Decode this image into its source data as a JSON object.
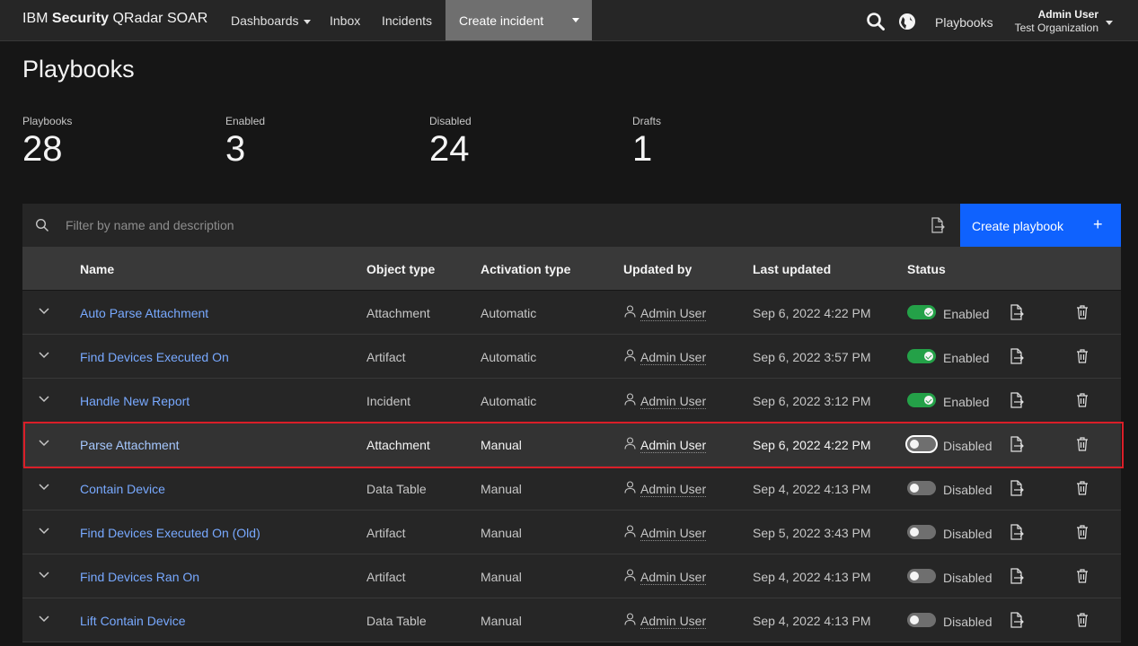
{
  "nav": {
    "brand_prefix": "IBM ",
    "brand_bold": "Security",
    "brand_suffix": " QRadar SOAR",
    "items": [
      "Dashboards",
      "Inbox",
      "Incidents"
    ],
    "create_incident": "Create incident",
    "playbooks_link": "Playbooks",
    "user_name": "Admin User",
    "user_org": "Test Organization",
    "icons": [
      "search-icon",
      "globe-icon"
    ]
  },
  "page": {
    "title": "Playbooks"
  },
  "stats": [
    {
      "label": "Playbooks",
      "value": "28"
    },
    {
      "label": "Enabled",
      "value": "3"
    },
    {
      "label": "Disabled",
      "value": "24"
    },
    {
      "label": "Drafts",
      "value": "1"
    }
  ],
  "toolbar": {
    "search_placeholder": "Filter by name and description",
    "create_label": "Create playbook",
    "create_icon": "+"
  },
  "table": {
    "columns": [
      "Name",
      "Object type",
      "Activation type",
      "Updated by",
      "Last updated",
      "Status"
    ],
    "rows": [
      {
        "name": "Auto Parse Attachment",
        "object_type": "Attachment",
        "activation": "Automatic",
        "updated_by": "Admin User",
        "last_updated": "Sep 6, 2022 4:22 PM",
        "status": "Enabled"
      },
      {
        "name": "Find Devices Executed On",
        "object_type": "Artifact",
        "activation": "Automatic",
        "updated_by": "Admin User",
        "last_updated": "Sep 6, 2022 3:57 PM",
        "status": "Enabled"
      },
      {
        "name": "Handle New Report",
        "object_type": "Incident",
        "activation": "Automatic",
        "updated_by": "Admin User",
        "last_updated": "Sep 6, 2022 3:12 PM",
        "status": "Enabled"
      },
      {
        "name": "Parse Attachment",
        "object_type": "Attachment",
        "activation": "Manual",
        "updated_by": "Admin User",
        "last_updated": "Sep 6, 2022 4:22 PM",
        "status": "Disabled"
      },
      {
        "name": "Contain Device",
        "object_type": "Data Table",
        "activation": "Manual",
        "updated_by": "Admin User",
        "last_updated": "Sep 4, 2022 4:13 PM",
        "status": "Disabled"
      },
      {
        "name": "Find Devices Executed On (Old)",
        "object_type": "Artifact",
        "activation": "Manual",
        "updated_by": "Admin User",
        "last_updated": "Sep 5, 2022 3:43 PM",
        "status": "Disabled"
      },
      {
        "name": "Find Devices Ran On",
        "object_type": "Artifact",
        "activation": "Manual",
        "updated_by": "Admin User",
        "last_updated": "Sep 4, 2022 4:13 PM",
        "status": "Disabled"
      },
      {
        "name": "Lift Contain Device",
        "object_type": "Data Table",
        "activation": "Manual",
        "updated_by": "Admin User",
        "last_updated": "Sep 4, 2022 4:13 PM",
        "status": "Disabled"
      }
    ]
  },
  "colors": {
    "accent": "#0f62fe",
    "enabled": "#24a148",
    "link": "#78a9ff",
    "highlight": "#da1e28"
  }
}
